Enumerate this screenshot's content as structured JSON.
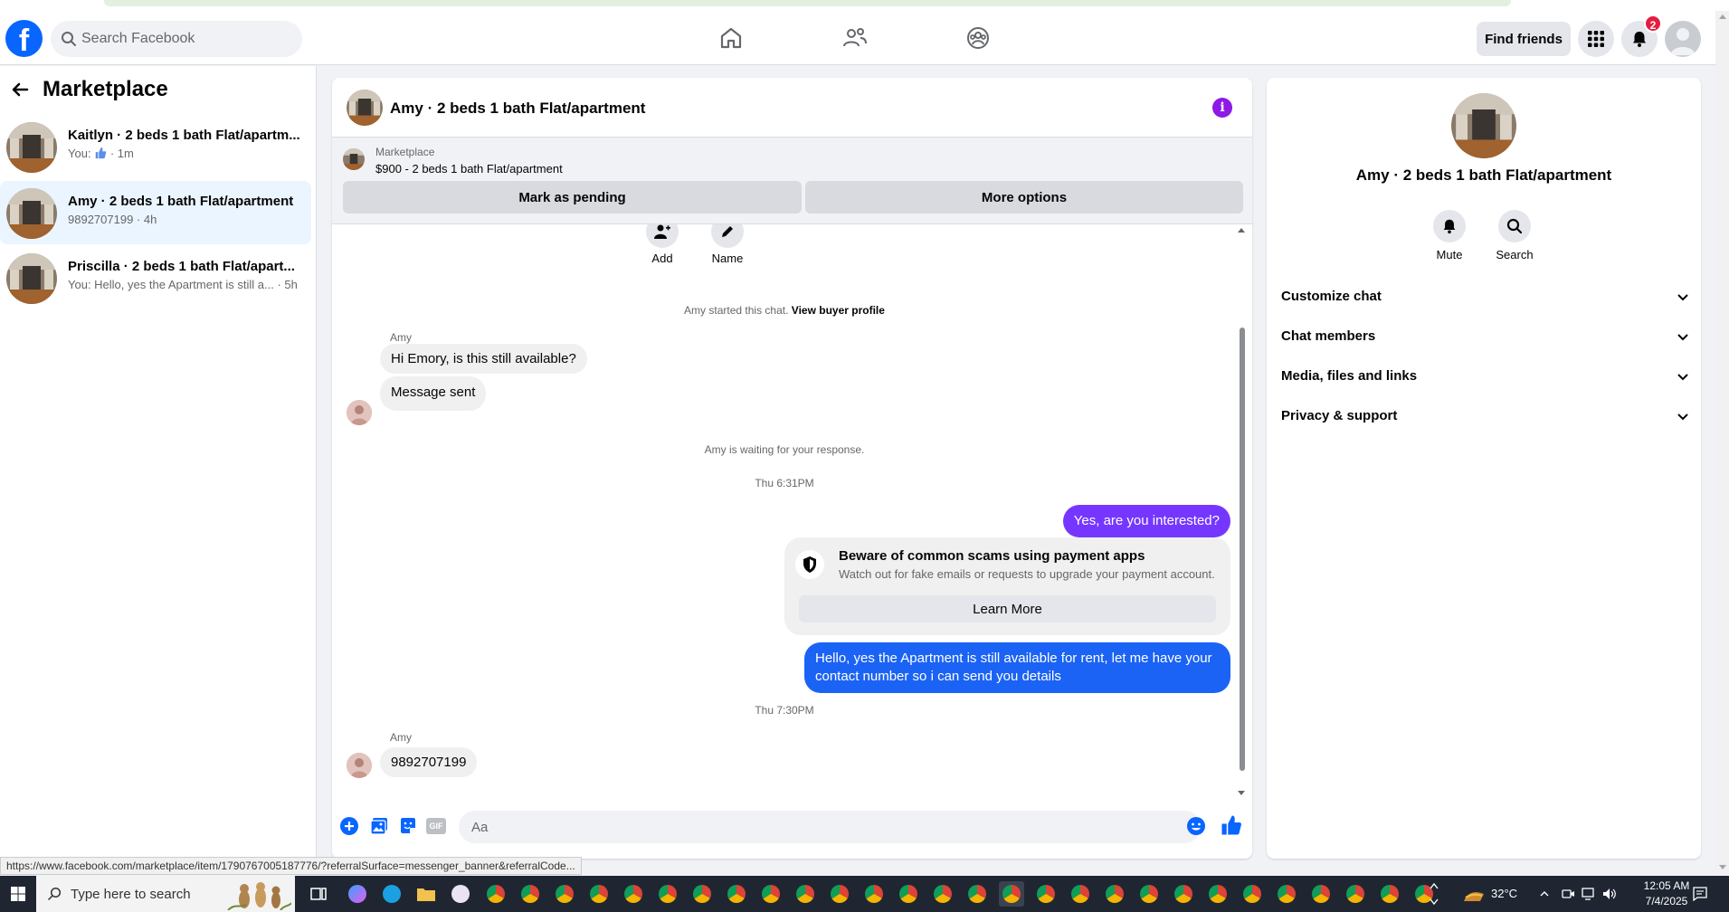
{
  "header": {
    "search_placeholder": "Search Facebook",
    "find_friends": "Find friends",
    "notification_count": "2"
  },
  "left": {
    "title": "Marketplace",
    "conversations": [
      {
        "name": "Kaitlyn · 2 beds 1 bath Flat/apartm...",
        "sub_prefix": "You:",
        "sub_suffix": "· 1m"
      },
      {
        "name": "Amy · 2 beds 1 bath Flat/apartment",
        "sub": "9892707199 · 4h"
      },
      {
        "name": "Priscilla · 2 beds 1 bath Flat/apart...",
        "sub": "You: Hello, yes the Apartment is still a... · 5h"
      }
    ]
  },
  "chat": {
    "title": "Amy · 2 beds 1 bath Flat/apartment",
    "info_glyph": "i",
    "listing": {
      "label": "Marketplace",
      "price_line": "$900 - 2 beds 1 bath Flat/apartment",
      "mark_pending": "Mark as pending",
      "more_options": "More options"
    },
    "actions": {
      "add": "Add",
      "name": "Name"
    },
    "started_text": "Amy started this chat.",
    "view_profile": "View buyer profile",
    "sender1": "Amy",
    "msg1": "Hi Emory, is this still available?",
    "msg2": "Message sent",
    "waiting": "Amy is waiting for your response.",
    "time1": "Thu 6:31PM",
    "out1": "Yes, are you interested?",
    "scam_title": "Beware of common scams using payment apps",
    "scam_desc": "Watch out for fake emails or requests to upgrade your payment account.",
    "learn_more": "Learn More",
    "out2": "Hello, yes the Apartment is still available for rent, let me have your contact number so i can send you details",
    "time2": "Thu 7:30PM",
    "sender2": "Amy",
    "msg3": "9892707199",
    "composer_placeholder": "Aa",
    "gif_label": "GIF"
  },
  "right": {
    "title": "Amy · 2 beds 1 bath Flat/apartment",
    "mute": "Mute",
    "search": "Search",
    "sections": [
      "Customize chat",
      "Chat members",
      "Media, files and links",
      "Privacy & support"
    ]
  },
  "status_url": "https://www.facebook.com/marketplace/item/1790767005187776/?referralSurface=messenger_banner&referralCode...",
  "taskbar": {
    "search_placeholder": "Type here to search",
    "temperature": "32°C",
    "time": "12:05 AM",
    "date": "7/4/2025"
  },
  "colors": {
    "accent": "#0866ff",
    "bubble_purple": "#7537ff",
    "bubble_blue": "#1b63f5"
  }
}
